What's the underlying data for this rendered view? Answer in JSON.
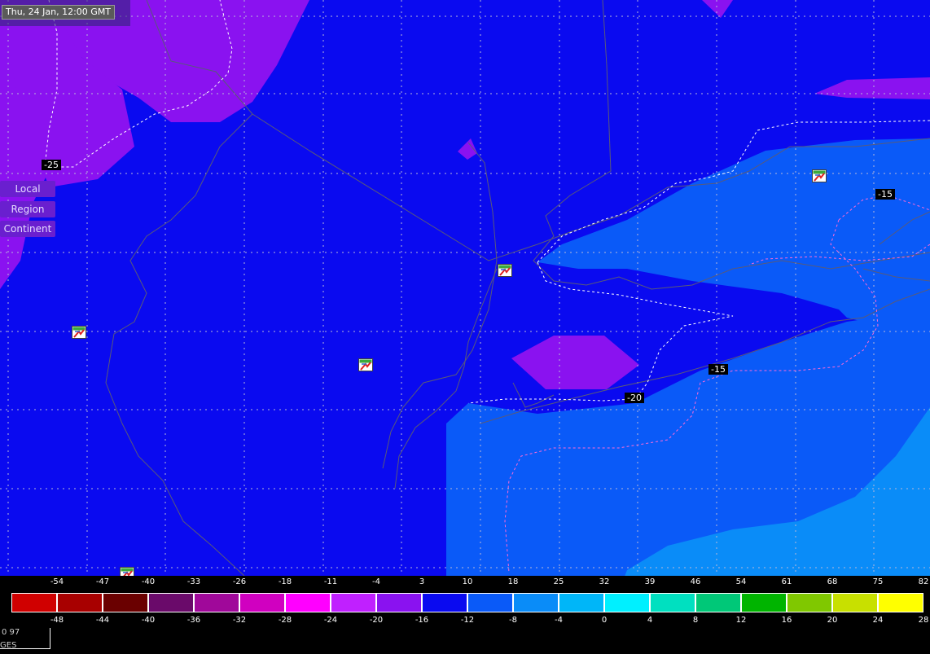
{
  "timestamp": "Thu, 24 Jan, 12:00 GMT",
  "scope_buttons": [
    "Local",
    "Region",
    "Continent"
  ],
  "contour_labels": [
    "-25",
    "-15",
    "-20",
    "-15"
  ],
  "stations": [
    {
      "name": "station-icon",
      "icon": "weather-station-icon"
    },
    {
      "name": "station-icon",
      "icon": "weather-station-icon"
    },
    {
      "name": "station-icon",
      "icon": "weather-station-icon"
    },
    {
      "name": "station-icon",
      "icon": "weather-station-icon"
    },
    {
      "name": "station-icon",
      "icon": "weather-station-icon"
    }
  ],
  "colors": {
    "deep_blue": "#0a0af0",
    "violet": "#8a12f0",
    "mid_blue": "#0a5af8",
    "light_blue": "#0a8cf8",
    "boundary": "#5a5a78",
    "isotherm_white": "#ffffff",
    "isotherm_pink": "#ff6ad6"
  },
  "legend": {
    "fahrenheit": [
      "-54",
      "-47",
      "-40",
      "-33",
      "-26",
      "-18",
      "-11",
      "-4",
      "3",
      "10",
      "18",
      "25",
      "32",
      "39",
      "46",
      "54",
      "61",
      "68",
      "75",
      "82"
    ],
    "celsius": [
      "-48",
      "-44",
      "-40",
      "-36",
      "-32",
      "-28",
      "-24",
      "-20",
      "-16",
      "-12",
      "-8",
      "-4",
      "0",
      "4",
      "8",
      "12",
      "16",
      "20",
      "24",
      "28"
    ],
    "colors": [
      "#d00000",
      "#a80000",
      "#6a0000",
      "#6a0a6a",
      "#a0089a",
      "#d000c0",
      "#ff00ff",
      "#c020ff",
      "#8a12f0",
      "#0a0af0",
      "#0a5af8",
      "#0a8cf8",
      "#00b6f8",
      "#00f0ff",
      "#00e0c0",
      "#00c878",
      "#00b400",
      "#80c800",
      "#c8e000",
      "#ffff00"
    ]
  },
  "footer": {
    "scale_text": "0 97",
    "bottom_text": "GES"
  }
}
